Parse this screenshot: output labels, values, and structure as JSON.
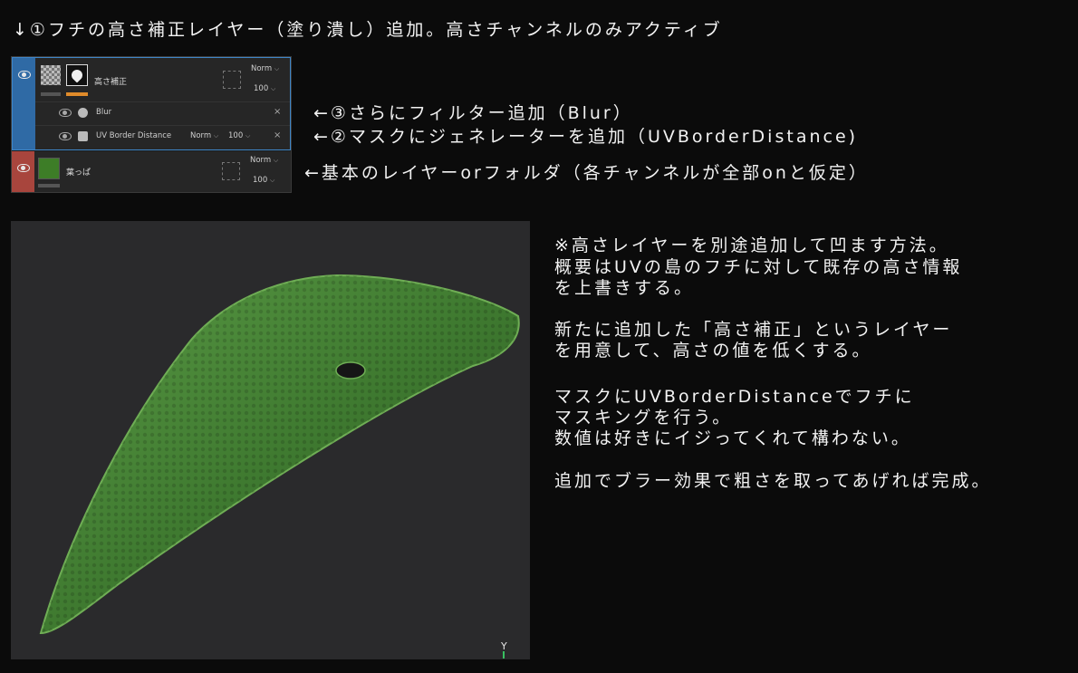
{
  "heading": "↓①フチの高さ補正レイヤー（塗り潰し）追加。高さチャンネルのみアクティブ",
  "layers_panel": {
    "group_layer": {
      "name": "高さ補正",
      "blend_mode": "Norm",
      "opacity": "100"
    },
    "filters": [
      {
        "name": "Blur"
      },
      {
        "name": "UV Border Distance",
        "blend_mode": "Norm",
        "opacity": "100"
      }
    ],
    "base_layer": {
      "name": "葉っぱ",
      "blend_mode": "Norm",
      "opacity": "100"
    }
  },
  "notes": {
    "filter_note": "←③さらにフィルター追加（Blur）",
    "generator_note": "←②マスクにジェネレーターを追加（UVBorderDistance)",
    "base_note": "←基本のレイヤーorフォルダ（各チャンネルが全部onと仮定）"
  },
  "viewport": {
    "axis_label": "Y"
  },
  "description": [
    "※高さレイヤーを別途追加して凹ます方法。",
    "概要はUVの島のフチに対して既存の高さ情報",
    "を上書きする。",
    "",
    "新たに追加した「高さ補正」というレイヤー",
    "を用意して、高さの値を低くする。",
    "",
    "マスクにUVBorderDistanceでフチに",
    "マスキングを行う。",
    "数値は好きにイジってくれて構わない。",
    "",
    "追加でブラー効果で粗さを取ってあげれば完成。"
  ],
  "colors": {
    "background": "#0b0b0b",
    "selection_blue": "#2f6aa5",
    "base_layer_red": "#a8453d",
    "accent_orange": "#e08b2a",
    "leaf_green": "#3d7d27"
  }
}
